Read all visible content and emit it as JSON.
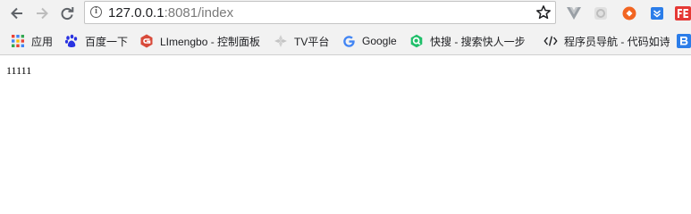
{
  "toolbar": {
    "url_host": "127.0.0.1",
    "url_rest": ":8081/index"
  },
  "bookmarks": [
    {
      "label": "应用",
      "icon": "apps-grid-icon"
    },
    {
      "label": "百度一下",
      "icon": "baidu-paw-icon"
    },
    {
      "label": "LImengbo - 控制面板",
      "icon": "gitee-icon"
    },
    {
      "label": "TV平台",
      "icon": "tv-platform-icon"
    },
    {
      "label": "Google",
      "icon": "google-icon"
    },
    {
      "label": "快搜 - 搜索快人一步",
      "icon": "kuaisou-icon"
    },
    {
      "label": "程序员导航 - 代码如诗",
      "icon": "code-brackets-icon"
    }
  ],
  "extensions": [
    {
      "name": "vue-devtools-icon",
      "color": "#9aa0a6"
    },
    {
      "name": "extension-gear-icon",
      "color": "#c7c7c7"
    },
    {
      "name": "orange-extension-icon",
      "color": "#f26522"
    },
    {
      "name": "blue-download-extension-icon",
      "color": "#2b7de9"
    },
    {
      "name": "fe-helper-icon",
      "color": "#e53935"
    }
  ],
  "page": {
    "text": "11111"
  }
}
